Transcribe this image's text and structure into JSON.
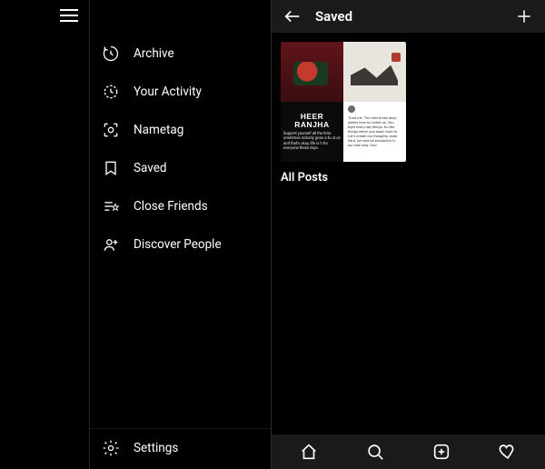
{
  "sidebar": {
    "items": [
      {
        "label": "Archive"
      },
      {
        "label": "Your Activity"
      },
      {
        "label": "Nametag"
      },
      {
        "label": "Saved"
      },
      {
        "label": "Close Friends"
      },
      {
        "label": "Discover People"
      }
    ],
    "settings_label": "Settings"
  },
  "header": {
    "title": "Saved"
  },
  "collection": {
    "label": "All Posts",
    "tile_title_top": "HEER",
    "tile_title_bottom": "RANJHA",
    "tile_caption": "Support yourself all the time. ometimes nobody gives a fu ut us and that's okay, life is h for everyone these days.",
    "tile4_name": "",
    "tile4_body": "Trust me. The next times days weeks how to rocket us. You fight every day things. Do the things which you want, have to. Let's create our thoughts, work hard, live and be productive in our own way. God."
  },
  "nav": {
    "home": "home-icon",
    "search": "search-icon",
    "add": "add-post-icon",
    "activity": "heart-icon"
  }
}
